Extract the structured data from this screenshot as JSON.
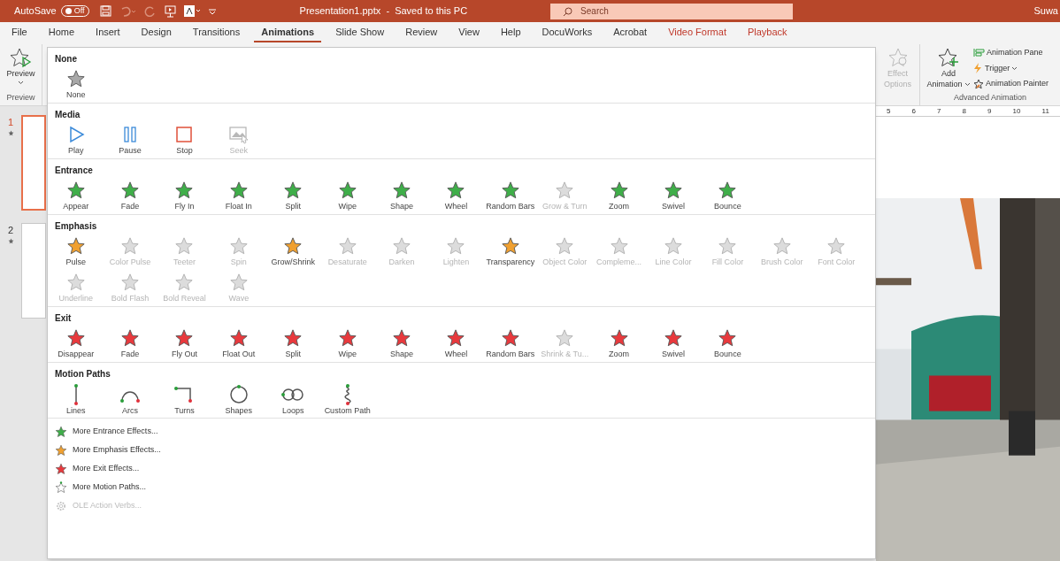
{
  "title_bar": {
    "autosave_label": "AutoSave",
    "autosave_state": "Off",
    "autosave_on": false,
    "document_title": "Presentation1.pptx  -  Saved to this PC",
    "search": {
      "placeholder": "Search"
    },
    "user": "Suwa"
  },
  "tabs": [
    {
      "label": "File",
      "kind": "normal",
      "selected": false
    },
    {
      "label": "Home",
      "kind": "normal",
      "selected": false
    },
    {
      "label": "Insert",
      "kind": "normal",
      "selected": false
    },
    {
      "label": "Design",
      "kind": "normal",
      "selected": false
    },
    {
      "label": "Transitions",
      "kind": "normal",
      "selected": false
    },
    {
      "label": "Animations",
      "kind": "normal",
      "selected": true
    },
    {
      "label": "Slide Show",
      "kind": "normal",
      "selected": false
    },
    {
      "label": "Review",
      "kind": "normal",
      "selected": false
    },
    {
      "label": "View",
      "kind": "normal",
      "selected": false
    },
    {
      "label": "Help",
      "kind": "normal",
      "selected": false
    },
    {
      "label": "DocuWorks",
      "kind": "normal",
      "selected": false
    },
    {
      "label": "Acrobat",
      "kind": "normal",
      "selected": false
    },
    {
      "label": "Video Format",
      "kind": "contextual",
      "selected": false
    },
    {
      "label": "Playback",
      "kind": "contextual",
      "selected": false
    }
  ],
  "ribbon": {
    "preview_button": "Preview",
    "preview_group": "Preview",
    "effect_options": [
      "Effect",
      "Options"
    ],
    "effect_options_disabled": true,
    "add_animation": [
      "Add",
      "Animation"
    ],
    "animation_pane": "Animation Pane",
    "trigger": "Trigger",
    "animation_painter": "Animation Painter",
    "advanced_group": "Advanced Animation"
  },
  "ruler": [
    "5",
    "6",
    "7",
    "8",
    "9",
    "10",
    "11"
  ],
  "slides": [
    {
      "number": "1",
      "selected": true
    },
    {
      "number": "2",
      "selected": false
    }
  ],
  "gallery": {
    "sections": [
      {
        "title": "None",
        "kind": "none",
        "items": [
          {
            "label": "None",
            "kind": "star",
            "disabled": false
          }
        ]
      },
      {
        "title": "Media",
        "kind": "media",
        "items": [
          {
            "label": "Play",
            "kind": "play",
            "disabled": false
          },
          {
            "label": "Pause",
            "kind": "pause",
            "disabled": false
          },
          {
            "label": "Stop",
            "kind": "stop",
            "disabled": false
          },
          {
            "label": "Seek",
            "kind": "seek",
            "disabled": true
          }
        ]
      },
      {
        "title": "Entrance",
        "kind": "entrance",
        "items": [
          {
            "label": "Appear",
            "kind": "star",
            "disabled": false
          },
          {
            "label": "Fade",
            "kind": "star",
            "disabled": false
          },
          {
            "label": "Fly In",
            "kind": "star",
            "disabled": false
          },
          {
            "label": "Float In",
            "kind": "star",
            "disabled": false
          },
          {
            "label": "Split",
            "kind": "star",
            "disabled": false
          },
          {
            "label": "Wipe",
            "kind": "star",
            "disabled": false
          },
          {
            "label": "Shape",
            "kind": "star",
            "disabled": false
          },
          {
            "label": "Wheel",
            "kind": "star",
            "disabled": false
          },
          {
            "label": "Random Bars",
            "kind": "star",
            "disabled": false
          },
          {
            "label": "Grow & Turn",
            "kind": "star",
            "disabled": true
          },
          {
            "label": "Zoom",
            "kind": "star",
            "disabled": false
          },
          {
            "label": "Swivel",
            "kind": "star",
            "disabled": false
          },
          {
            "label": "Bounce",
            "kind": "star",
            "disabled": false
          }
        ]
      },
      {
        "title": "Emphasis",
        "kind": "emphasis",
        "items": [
          {
            "label": "Pulse",
            "kind": "star",
            "disabled": false
          },
          {
            "label": "Color Pulse",
            "kind": "star",
            "disabled": true
          },
          {
            "label": "Teeter",
            "kind": "star",
            "disabled": true
          },
          {
            "label": "Spin",
            "kind": "star",
            "disabled": true
          },
          {
            "label": "Grow/Shrink",
            "kind": "star",
            "disabled": false
          },
          {
            "label": "Desaturate",
            "kind": "star",
            "disabled": true
          },
          {
            "label": "Darken",
            "kind": "star",
            "disabled": true
          },
          {
            "label": "Lighten",
            "kind": "star",
            "disabled": true
          },
          {
            "label": "Transparency",
            "kind": "star",
            "disabled": false
          },
          {
            "label": "Object Color",
            "kind": "star",
            "disabled": true
          },
          {
            "label": "Compleme...",
            "kind": "star",
            "disabled": true
          },
          {
            "label": "Line Color",
            "kind": "star",
            "disabled": true
          },
          {
            "label": "Fill Color",
            "kind": "star",
            "disabled": true
          },
          {
            "label": "Brush Color",
            "kind": "star",
            "disabled": true
          },
          {
            "label": "Font Color",
            "kind": "star",
            "disabled": true
          },
          {
            "label": "Underline",
            "kind": "star",
            "disabled": true
          },
          {
            "label": "Bold Flash",
            "kind": "star",
            "disabled": true
          },
          {
            "label": "Bold Reveal",
            "kind": "star",
            "disabled": true
          },
          {
            "label": "Wave",
            "kind": "star",
            "disabled": true
          }
        ]
      },
      {
        "title": "Exit",
        "kind": "exit",
        "items": [
          {
            "label": "Disappear",
            "kind": "star",
            "disabled": false
          },
          {
            "label": "Fade",
            "kind": "star",
            "disabled": false
          },
          {
            "label": "Fly Out",
            "kind": "star",
            "disabled": false
          },
          {
            "label": "Float Out",
            "kind": "star",
            "disabled": false
          },
          {
            "label": "Split",
            "kind": "star",
            "disabled": false
          },
          {
            "label": "Wipe",
            "kind": "star",
            "disabled": false
          },
          {
            "label": "Shape",
            "kind": "star",
            "disabled": false
          },
          {
            "label": "Wheel",
            "kind": "star",
            "disabled": false
          },
          {
            "label": "Random Bars",
            "kind": "star",
            "disabled": false
          },
          {
            "label": "Shrink & Tu...",
            "kind": "star",
            "disabled": true
          },
          {
            "label": "Zoom",
            "kind": "star",
            "disabled": false
          },
          {
            "label": "Swivel",
            "kind": "star",
            "disabled": false
          },
          {
            "label": "Bounce",
            "kind": "star",
            "disabled": false
          }
        ]
      },
      {
        "title": "Motion Paths",
        "kind": "motion",
        "items": [
          {
            "label": "Lines",
            "kind": "lines",
            "disabled": false
          },
          {
            "label": "Arcs",
            "kind": "arcs",
            "disabled": false
          },
          {
            "label": "Turns",
            "kind": "turns",
            "disabled": false
          },
          {
            "label": "Shapes",
            "kind": "shapes",
            "disabled": false
          },
          {
            "label": "Loops",
            "kind": "loops",
            "disabled": false
          },
          {
            "label": "Custom Path",
            "kind": "custom",
            "disabled": false
          }
        ]
      }
    ],
    "more": [
      {
        "label": "More Entrance Effects...",
        "kind": "entrance",
        "disabled": false
      },
      {
        "label": "More Emphasis Effects...",
        "kind": "emphasis",
        "disabled": false
      },
      {
        "label": "More Exit Effects...",
        "kind": "exit",
        "disabled": false
      },
      {
        "label": "More Motion Paths...",
        "kind": "motion",
        "disabled": false
      },
      {
        "label": "OLE Action Verbs...",
        "kind": "ole",
        "disabled": true
      }
    ]
  }
}
